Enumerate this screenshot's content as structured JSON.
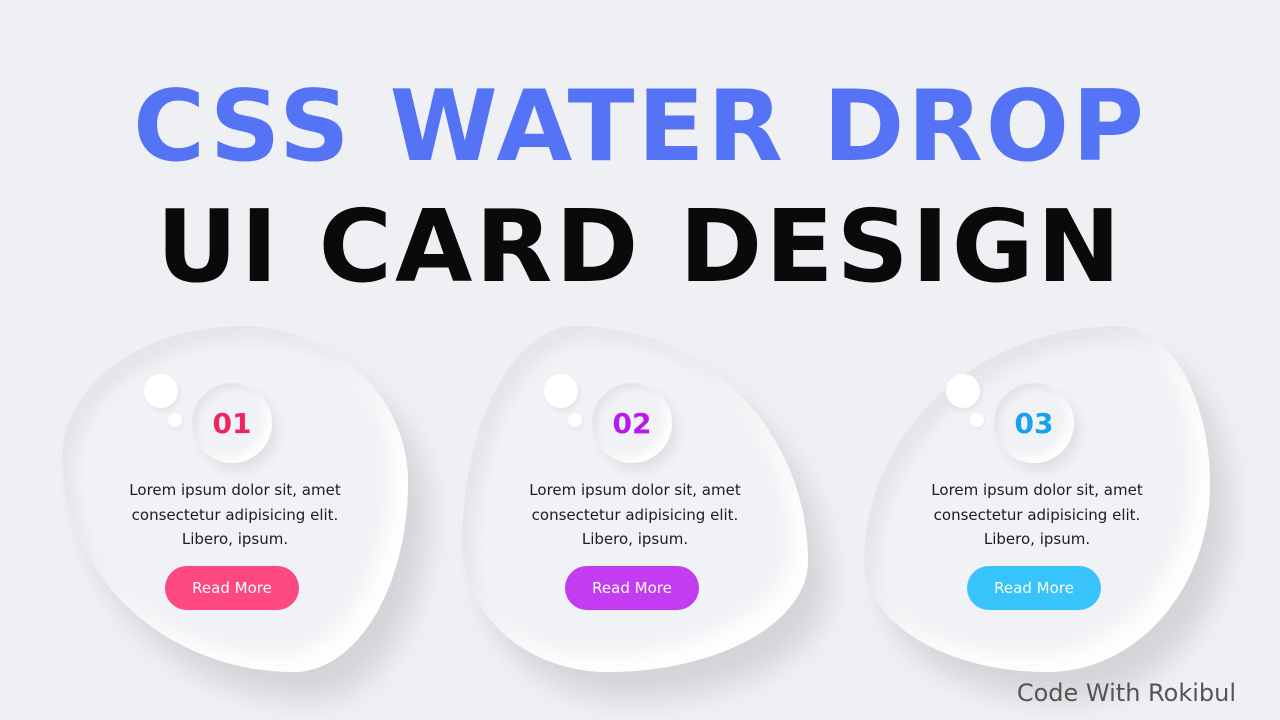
{
  "header": {
    "title_line1": "CSS WATER DROP",
    "title_line2": "UI CARD DESIGN",
    "title_line1_color": "#5574f5",
    "title_line2_color": "#0a0a0a"
  },
  "cards": [
    {
      "number": "01",
      "accent_color": "#f0245e",
      "text_line1": "Lorem ipsum dolor sit, amet",
      "text_line2": "consectetur adipisicing elit.",
      "text_line3": "Libero, ipsum.",
      "button_label": "Read More",
      "button_color": "#fd4980"
    },
    {
      "number": "02",
      "accent_color": "#b81aeb",
      "text_line1": "Lorem ipsum dolor sit, amet",
      "text_line2": "consectetur adipisicing elit.",
      "text_line3": "Libero, ipsum.",
      "button_label": "Read More",
      "button_color": "#c33cf2"
    },
    {
      "number": "03",
      "accent_color": "#17a3ef",
      "text_line1": "Lorem ipsum dolor sit, amet",
      "text_line2": "consectetur adipisicing elit.",
      "text_line3": "Libero, ipsum.",
      "button_label": "Read More",
      "button_color": "#38c4fb"
    }
  ],
  "footer": {
    "credit": "Code With Rokibul"
  }
}
